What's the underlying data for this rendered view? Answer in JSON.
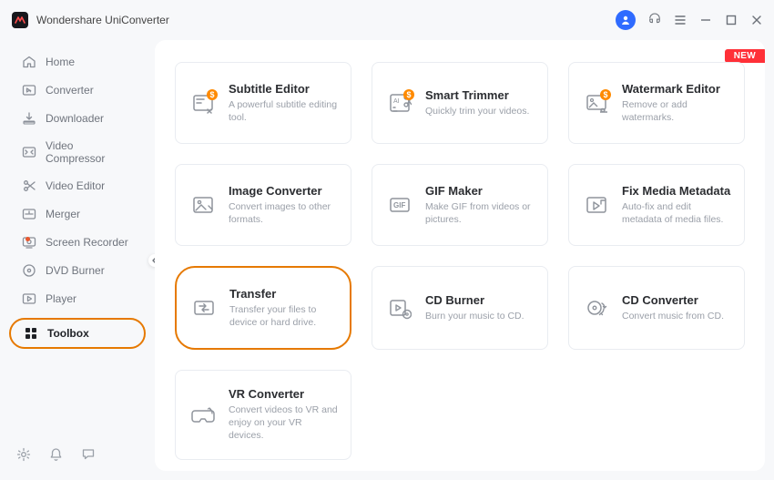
{
  "app_title": "Wondershare UniConverter",
  "new_label": "NEW",
  "sidebar": [
    {
      "id": "home",
      "label": "Home",
      "icon": "home-icon"
    },
    {
      "id": "converter",
      "label": "Converter",
      "icon": "converter-icon"
    },
    {
      "id": "downloader",
      "label": "Downloader",
      "icon": "download-icon"
    },
    {
      "id": "compressor",
      "label": "Video Compressor",
      "icon": "compress-icon"
    },
    {
      "id": "editor",
      "label": "Video Editor",
      "icon": "scissors-icon"
    },
    {
      "id": "merger",
      "label": "Merger",
      "icon": "merger-icon"
    },
    {
      "id": "recorder",
      "label": "Screen Recorder",
      "icon": "recorder-icon",
      "dot": true
    },
    {
      "id": "dvd",
      "label": "DVD Burner",
      "icon": "disc-icon"
    },
    {
      "id": "player",
      "label": "Player",
      "icon": "play-icon"
    },
    {
      "id": "toolbox",
      "label": "Toolbox",
      "icon": "toolbox-icon",
      "active": true
    }
  ],
  "tools": [
    {
      "id": "subtitle",
      "title": "Subtitle Editor",
      "desc": "A powerful subtitle editing tool.",
      "icon": "subtitle-icon",
      "badge": "$"
    },
    {
      "id": "trimmer",
      "title": "Smart Trimmer",
      "desc": "Quickly trim your videos.",
      "icon": "trimmer-icon",
      "badge": "$"
    },
    {
      "id": "watermark",
      "title": "Watermark Editor",
      "desc": "Remove or add watermarks.",
      "icon": "watermark-icon",
      "badge": "$"
    },
    {
      "id": "imageconv",
      "title": "Image Converter",
      "desc": "Convert images to other formats.",
      "icon": "image-icon"
    },
    {
      "id": "gif",
      "title": "GIF Maker",
      "desc": "Make GIF from videos or pictures.",
      "icon": "gif-icon"
    },
    {
      "id": "metadata",
      "title": "Fix Media Metadata",
      "desc": "Auto-fix and edit metadata of media files.",
      "icon": "metadata-icon"
    },
    {
      "id": "transfer",
      "title": "Transfer",
      "desc": "Transfer your files to device or hard drive.",
      "icon": "transfer-icon",
      "highlight": true
    },
    {
      "id": "cdburn",
      "title": "CD Burner",
      "desc": "Burn your music to CD.",
      "icon": "cdburn-icon"
    },
    {
      "id": "cdconv",
      "title": "CD Converter",
      "desc": "Convert music from CD.",
      "icon": "cdconv-icon"
    },
    {
      "id": "vr",
      "title": "VR Converter",
      "desc": "Convert videos to VR and enjoy on your VR devices.",
      "icon": "vr-icon"
    }
  ]
}
